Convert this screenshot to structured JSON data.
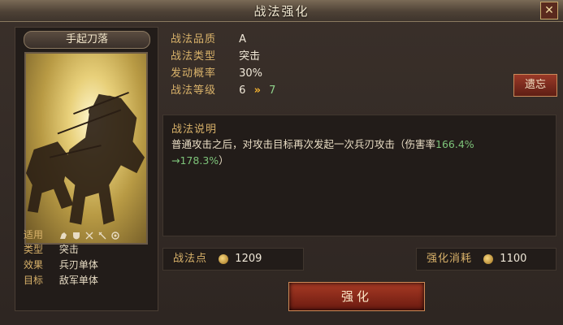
{
  "window": {
    "title": "战法强化",
    "close_glyph": "✕"
  },
  "skill": {
    "name": "手起刀落",
    "applicable_label": "适用",
    "applicable_icons": [
      "cavalry-icon",
      "shield-icon",
      "bow-icon",
      "spear-icon",
      "siege-icon"
    ],
    "type_label": "类型",
    "type_value": "突击",
    "effect_label": "效果",
    "effect_value": "兵刃单体",
    "target_label": "目标",
    "target_value": "敌军单体"
  },
  "attributes": {
    "quality_label": "战法品质",
    "quality_value": "A",
    "kind_label": "战法类型",
    "kind_value": "突击",
    "rate_label": "发动概率",
    "rate_value": "30%",
    "level_label": "战法等级",
    "level_current": "6",
    "level_next": "7"
  },
  "forget_button": "遗忘",
  "description": {
    "title": "战法说明",
    "text_before": "普通攻击之后，对攻击目标再次发起一次兵刃攻击（伤害率",
    "damage_from": "166.4%",
    "arrow_text": "→",
    "damage_to": "178.3%",
    "text_after": "）"
  },
  "resources": {
    "points_label": "战法点",
    "points_value": "1209",
    "cost_label": "强化消耗",
    "cost_value": "1100"
  },
  "enhance_button": "强化",
  "colors": {
    "gold": "#d9b26a",
    "highlight": "#7ec47a",
    "button_red": "#a83a24"
  }
}
